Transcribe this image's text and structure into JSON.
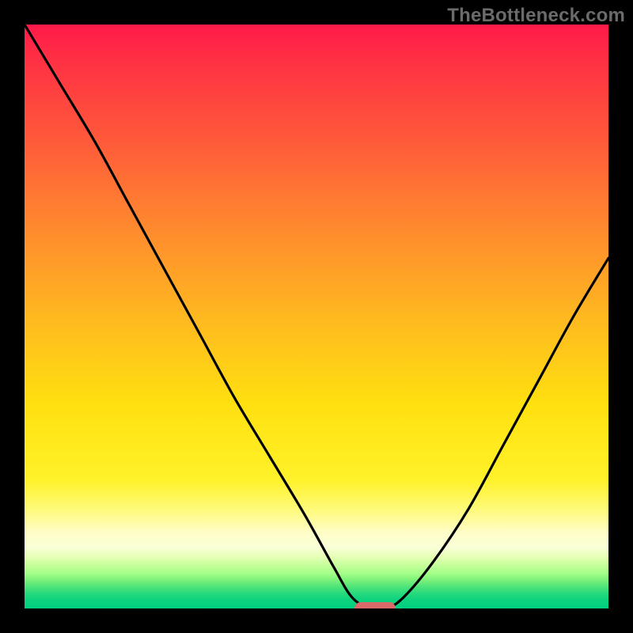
{
  "watermark": "TheBottleneck.com",
  "chart_data": {
    "type": "line",
    "title": "",
    "xlabel": "",
    "ylabel": "",
    "xlim": [
      0,
      100
    ],
    "ylim": [
      0,
      100
    ],
    "grid": false,
    "series": [
      {
        "name": "bottleneck-curve",
        "x": [
          0,
          6,
          12,
          18,
          24,
          30,
          36,
          42,
          48,
          53,
          56,
          59,
          62,
          65,
          70,
          76,
          82,
          88,
          94,
          100
        ],
        "y": [
          100,
          90,
          80,
          69,
          58,
          47,
          36,
          26,
          16,
          7,
          2,
          0,
          0,
          2,
          8,
          17,
          28,
          39,
          50,
          60
        ]
      }
    ],
    "optimum_marker": {
      "x": 60,
      "y": 0
    },
    "annotations": []
  },
  "colors": {
    "frame": "#000000",
    "curve": "#000000",
    "marker": "#d96a6a",
    "watermark": "#6b6b6b"
  }
}
